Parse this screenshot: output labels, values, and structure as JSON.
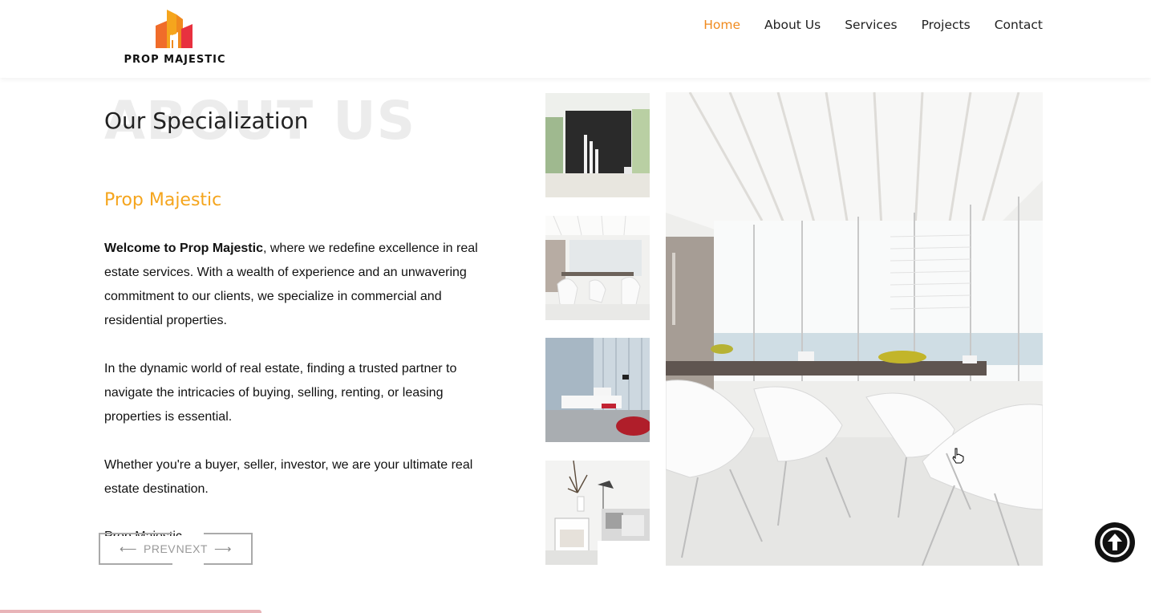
{
  "header": {
    "logo_text": "PROP MAJESTIC",
    "nav": [
      {
        "label": "Home",
        "active": true
      },
      {
        "label": "About Us",
        "active": false
      },
      {
        "label": "Services",
        "active": false
      },
      {
        "label": "Projects",
        "active": false
      },
      {
        "label": "Contact",
        "active": false
      }
    ]
  },
  "main": {
    "background_title": "ABOUT US",
    "section_title": "Our Specialization",
    "brand_title": "Prop Majestic",
    "paragraph1_bold": "Welcome to Prop Majestic",
    "paragraph1_rest": ", where we redefine excellence in real estate services. With a wealth of experience and an unwavering commitment to our clients, we specialize in commercial and residential properties.",
    "paragraph2": "In the dynamic world of real estate, finding a trusted partner to navigate the intricacies of buying, selling, renting, or leasing properties is essential.",
    "paragraph3": "Whether you're a buyer, seller, investor, we are your ultimate real estate destination.",
    "clipped_text": "Prop Majestic"
  },
  "slider": {
    "prev_label": "PREV",
    "next_label": "NEXT",
    "prev_icon": "arrow-left-icon",
    "next_icon": "arrow-right-icon"
  },
  "gallery": {
    "thumbnails": [
      "black-wall-vases",
      "white-dining-room",
      "living-room-sea-view",
      "bedroom-decor"
    ],
    "main_image": "white-dining-room"
  },
  "colors": {
    "accent": "#f08a1e",
    "brand": "#f5a51d"
  },
  "scroll_top_icon": "arrow-up-circle-icon"
}
